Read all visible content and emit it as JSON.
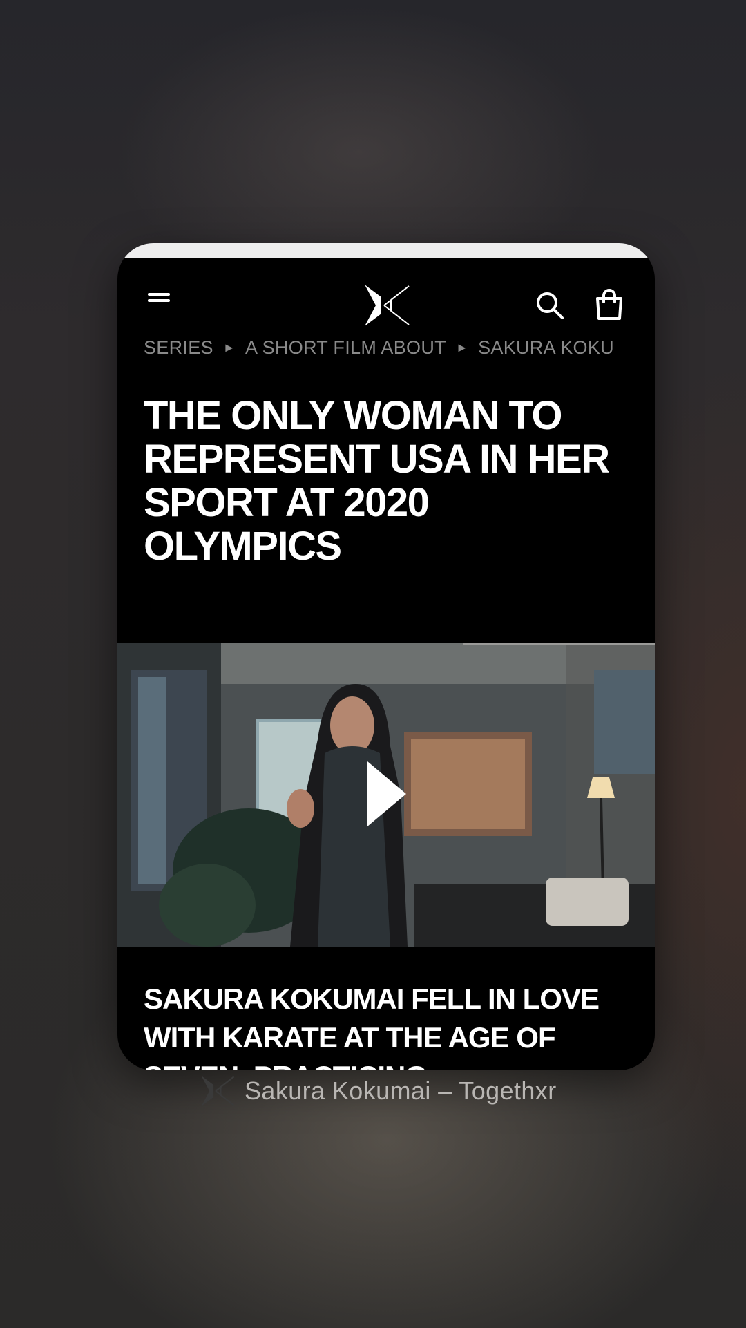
{
  "app_card": {
    "breadcrumb": {
      "item1": "SERIES",
      "item2": "A SHORT FILM ABOUT",
      "item3": "SAKURA KOKU",
      "separator": "►"
    },
    "headline": "THE ONLY WOMAN TO REPRESENT USA IN HER SPORT AT 2020 OLYMPICS",
    "subhead": "SAKURA KOKUMAI FELL IN LOVE WITH KARATE AT THE AGE OF SEVEN, PRACTICING",
    "icons": {
      "menu": "hamburger-menu-icon",
      "logo": "togethxr-logo",
      "search": "search-icon",
      "bag": "shopping-bag-icon",
      "play": "play-icon"
    }
  },
  "app_switcher": {
    "caption": "Sakura Kokumai – Togethxr"
  },
  "colors": {
    "card_bg": "#000000",
    "breadcrumb": "#8a8a8a",
    "caption_text": "#b9b6b3"
  }
}
